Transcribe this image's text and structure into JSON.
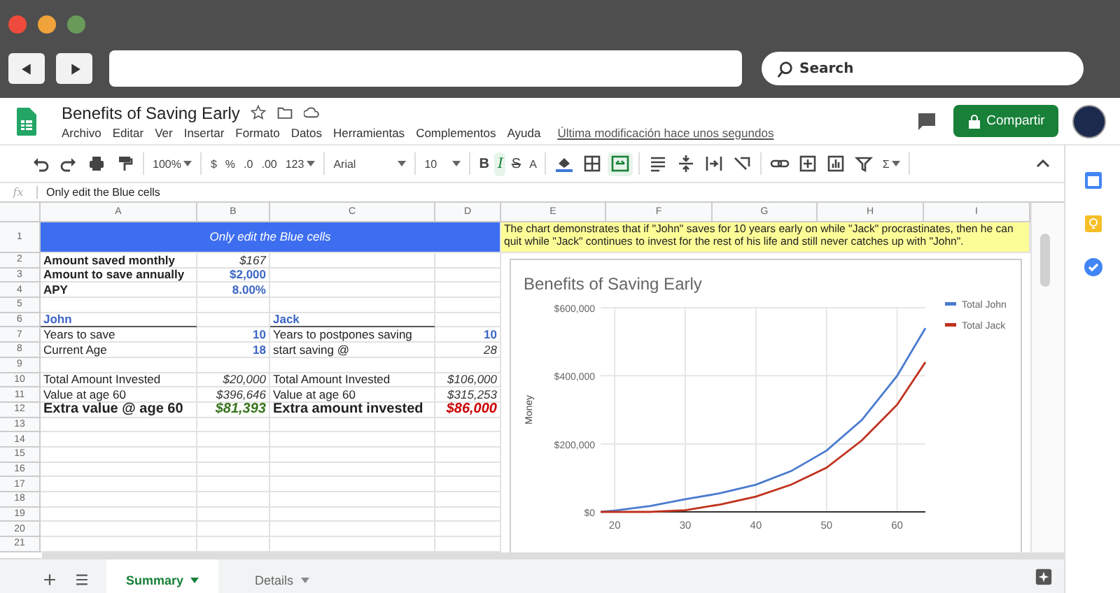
{
  "browser": {
    "search": {
      "placeholder": "Search"
    }
  },
  "document": {
    "title": "Benefits of Saving Early",
    "last_edit": "Última modificación hace unos segundos",
    "share_button": "Compartir"
  },
  "menu": [
    "Archivo",
    "Editar",
    "Ver",
    "Insertar",
    "Formato",
    "Datos",
    "Herramientas",
    "Complementos",
    "Ayuda"
  ],
  "toolbar": [
    {
      "items": [
        {
          "kind": "icon",
          "on": false
        },
        {
          "kind": "icon",
          "on": false
        },
        {
          "kind": "icon",
          "on": false
        },
        {
          "kind": "icon",
          "on": false
        }
      ]
    },
    {
      "items": [
        {
          "kind": "dropdown",
          "label": "100%",
          "on": false
        }
      ]
    },
    {
      "items": [
        {
          "kind": "text",
          "label": "$",
          "on": false
        },
        {
          "kind": "text",
          "label": "%",
          "on": false
        },
        {
          "kind": "text",
          "label": ".0",
          "on": false
        },
        {
          "kind": "text",
          "label": ".00",
          "on": false
        },
        {
          "kind": "dropdown",
          "label": "123",
          "on": false
        }
      ]
    },
    {
      "items": [
        {
          "kind": "font",
          "label": "Arial",
          "on": false
        }
      ]
    },
    {
      "items": [
        {
          "kind": "font-size",
          "label": "10",
          "on": false
        }
      ]
    },
    {
      "items": [
        {
          "kind": "bold",
          "label": "B",
          "on": false
        },
        {
          "kind": "italic",
          "label": "I",
          "on": true
        },
        {
          "kind": "strike",
          "label": "S",
          "on": false
        },
        {
          "kind": "text",
          "label": "A",
          "on": false
        }
      ]
    },
    {
      "items": [
        {
          "kind": "icon",
          "on": false
        },
        {
          "kind": "icon",
          "on": false
        },
        {
          "kind": "icon",
          "on": true
        }
      ]
    },
    {
      "items": [
        {
          "kind": "icon",
          "on": false
        },
        {
          "kind": "icon",
          "on": false
        },
        {
          "kind": "icon",
          "on": false
        },
        {
          "kind": "icon",
          "on": false
        }
      ]
    },
    {
      "items": [
        {
          "kind": "icon",
          "on": false
        },
        {
          "kind": "icon",
          "on": false
        },
        {
          "kind": "icon",
          "on": false
        },
        {
          "kind": "icon",
          "on": false
        },
        {
          "kind": "dropdown",
          "label": "Σ",
          "on": false
        }
      ]
    },
    {
      "items": [
        {
          "kind": "icon",
          "on": false
        }
      ]
    }
  ],
  "formula_bar": {
    "label": "fx",
    "value": "Only edit the Blue cells"
  },
  "columns": [
    "A",
    "B",
    "C",
    "D",
    "E",
    "F",
    "G",
    "H",
    "I"
  ],
  "rows": [
    {
      "number": "1",
      "merged_a_d": {
        "text": "Only edit the Blue cells",
        "kind": "banner"
      },
      "e": {
        "text": "The chart demonstrates that if \"John\" saves for 10 years early on while \"Jack\" procrastinates, then he can quit while \"Jack\" continues to invest for the rest of his life and still never catches up with \"John\".",
        "kind": "note"
      }
    },
    {
      "number": "2",
      "a": {
        "text": "Amount saved monthly",
        "kind": "label-bold"
      },
      "b": {
        "text": "$167",
        "kind": "formula"
      }
    },
    {
      "number": "3",
      "a": {
        "text": "Amount to save annually",
        "kind": "label-bold"
      },
      "b": {
        "text": "$2,000",
        "kind": "input"
      }
    },
    {
      "number": "4",
      "a": {
        "text": "APY",
        "kind": "label-bold"
      },
      "b": {
        "text": "8.00%",
        "kind": "input"
      }
    },
    {
      "number": "5"
    },
    {
      "number": "6",
      "a": {
        "text": "John",
        "kind": "section"
      },
      "c": {
        "text": "Jack",
        "kind": "section"
      }
    },
    {
      "number": "7",
      "a": {
        "text": "Years to save",
        "kind": "label"
      },
      "b": {
        "text": "10",
        "kind": "input"
      },
      "c": {
        "text": "Years to postpones saving",
        "kind": "label"
      },
      "d": {
        "text": "10",
        "kind": "input"
      }
    },
    {
      "number": "8",
      "a": {
        "text": "Current Age",
        "kind": "label"
      },
      "b": {
        "text": "18",
        "kind": "input"
      },
      "c": {
        "text": "start saving @",
        "kind": "label"
      },
      "d": {
        "text": "28",
        "kind": "formula"
      }
    },
    {
      "number": "9"
    },
    {
      "number": "10",
      "a": {
        "text": "Total Amount Invested",
        "kind": "label"
      },
      "b": {
        "text": "$20,000",
        "kind": "formula"
      },
      "c": {
        "text": "Total Amount Invested",
        "kind": "label"
      },
      "d": {
        "text": "$106,000",
        "kind": "formula"
      }
    },
    {
      "number": "11",
      "a": {
        "text": "Value at age 60",
        "kind": "label"
      },
      "b": {
        "text": "$396,646",
        "kind": "formula"
      },
      "c": {
        "text": "Value at age 60",
        "kind": "label"
      },
      "d": {
        "text": "$315,253",
        "kind": "formula"
      }
    },
    {
      "number": "12",
      "a": {
        "text": "Extra value @ age 60",
        "kind": "big-label"
      },
      "b": {
        "text": "$81,393",
        "kind": "gain"
      },
      "c": {
        "text": "Extra amount invested",
        "kind": "big-label"
      },
      "d": {
        "text": "$86,000",
        "kind": "loss"
      }
    },
    {
      "number": "13"
    },
    {
      "number": "14"
    },
    {
      "number": "15"
    },
    {
      "number": "16"
    },
    {
      "number": "17"
    },
    {
      "number": "18"
    },
    {
      "number": "19"
    },
    {
      "number": "20"
    },
    {
      "number": "21"
    }
  ],
  "chart": {
    "chart_data": {
      "type": "line",
      "title": "Benefits of Saving Early",
      "ylabel": "Money",
      "x": [
        18,
        20,
        25,
        30,
        35,
        40,
        45,
        50,
        55,
        60,
        64
      ],
      "series": [
        {
          "name": "Total John",
          "color": "#4a7bd0",
          "values": [
            0,
            4000,
            17000,
            37000,
            55000,
            80000,
            120000,
            180000,
            270000,
            400000,
            540000
          ]
        },
        {
          "name": "Total Jack",
          "color": "#c0321e",
          "values": [
            0,
            0,
            0,
            5000,
            22000,
            45000,
            80000,
            130000,
            210000,
            315000,
            440000
          ]
        }
      ],
      "grid": true,
      "legend": true,
      "xlim": [
        18,
        64
      ],
      "ylim": [
        0,
        600000
      ],
      "xticks": [
        20,
        30,
        40,
        50,
        60
      ],
      "yticks": [
        {
          "value": 0,
          "label": "$0"
        },
        {
          "value": 200000,
          "label": "$200,000"
        },
        {
          "value": 400000,
          "label": "$400,000"
        },
        {
          "value": 600000,
          "label": "$600,000"
        }
      ]
    }
  },
  "sheet_tabs": [
    {
      "label": "Summary",
      "selected": true
    },
    {
      "label": "Details",
      "selected": false
    }
  ]
}
